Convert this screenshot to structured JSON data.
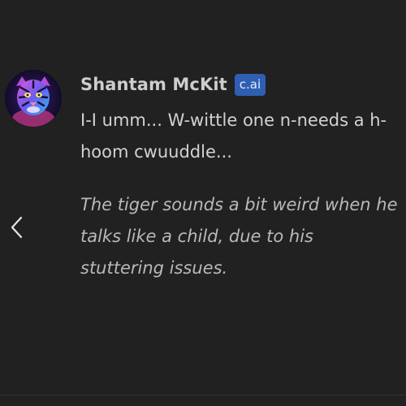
{
  "message": {
    "sender_name": "Shantam McKit",
    "badge": "c.ai",
    "text": "I-I umm... W-wittle one n-needs a h-hoom cwuuddle...",
    "narration": "The tiger sounds a bit weird when he talks like a child, due to his stuttering issues."
  },
  "icons": {
    "avatar": "tiger-avatar",
    "prev": "chevron-left-icon"
  },
  "colors": {
    "background": "#212121",
    "badge_background": "#2f5fb3",
    "text": "#d2d2d2",
    "narration_text": "#b9b9b9"
  }
}
